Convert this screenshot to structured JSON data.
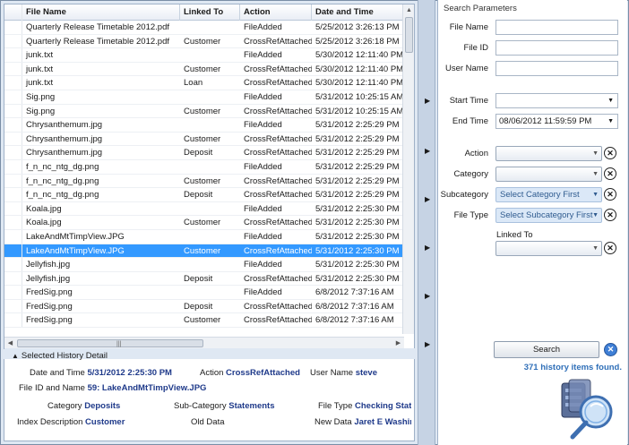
{
  "grid": {
    "columns": [
      "File Name",
      "Linked To",
      "Action",
      "Date and Time"
    ],
    "rows": [
      {
        "file": "Quarterly Release Timetable 2012.pdf",
        "linked": "",
        "action": "FileAdded",
        "date": "5/25/2012 3:26:13 PM",
        "selected": false
      },
      {
        "file": "Quarterly Release Timetable 2012.pdf",
        "linked": "Customer",
        "action": "CrossRefAttached",
        "date": "5/25/2012 3:26:18 PM",
        "selected": false
      },
      {
        "file": "junk.txt",
        "linked": "",
        "action": "FileAdded",
        "date": "5/30/2012 12:11:40 PM",
        "selected": false
      },
      {
        "file": "junk.txt",
        "linked": "Customer",
        "action": "CrossRefAttached",
        "date": "5/30/2012 12:11:40 PM",
        "selected": false
      },
      {
        "file": "junk.txt",
        "linked": "Loan",
        "action": "CrossRefAttached",
        "date": "5/30/2012 12:11:40 PM",
        "selected": false
      },
      {
        "file": "Sig.png",
        "linked": "",
        "action": "FileAdded",
        "date": "5/31/2012 10:25:15 AM",
        "selected": false
      },
      {
        "file": "Sig.png",
        "linked": "Customer",
        "action": "CrossRefAttached",
        "date": "5/31/2012 10:25:15 AM",
        "selected": false
      },
      {
        "file": "Chrysanthemum.jpg",
        "linked": "",
        "action": "FileAdded",
        "date": "5/31/2012 2:25:29 PM",
        "selected": false
      },
      {
        "file": "Chrysanthemum.jpg",
        "linked": "Customer",
        "action": "CrossRefAttached",
        "date": "5/31/2012 2:25:29 PM",
        "selected": false
      },
      {
        "file": "Chrysanthemum.jpg",
        "linked": "Deposit",
        "action": "CrossRefAttached",
        "date": "5/31/2012 2:25:29 PM",
        "selected": false
      },
      {
        "file": "f_n_nc_ntg_dg.png",
        "linked": "",
        "action": "FileAdded",
        "date": "5/31/2012 2:25:29 PM",
        "selected": false
      },
      {
        "file": "f_n_nc_ntg_dg.png",
        "linked": "Customer",
        "action": "CrossRefAttached",
        "date": "5/31/2012 2:25:29 PM",
        "selected": false
      },
      {
        "file": "f_n_nc_ntg_dg.png",
        "linked": "Deposit",
        "action": "CrossRefAttached",
        "date": "5/31/2012 2:25:29 PM",
        "selected": false
      },
      {
        "file": "Koala.jpg",
        "linked": "",
        "action": "FileAdded",
        "date": "5/31/2012 2:25:30 PM",
        "selected": false
      },
      {
        "file": "Koala.jpg",
        "linked": "Customer",
        "action": "CrossRefAttached",
        "date": "5/31/2012 2:25:30 PM",
        "selected": false
      },
      {
        "file": "LakeAndMtTimpView.JPG",
        "linked": "",
        "action": "FileAdded",
        "date": "5/31/2012 2:25:30 PM",
        "selected": false
      },
      {
        "file": "LakeAndMtTimpView.JPG",
        "linked": "Customer",
        "action": "CrossRefAttached",
        "date": "5/31/2012 2:25:30 PM",
        "selected": true
      },
      {
        "file": "Jellyfish.jpg",
        "linked": "",
        "action": "FileAdded",
        "date": "5/31/2012 2:25:30 PM",
        "selected": false
      },
      {
        "file": "Jellyfish.jpg",
        "linked": "Deposit",
        "action": "CrossRefAttached",
        "date": "5/31/2012 2:25:30 PM",
        "selected": false
      },
      {
        "file": "FredSig.png",
        "linked": "",
        "action": "FileAdded",
        "date": "6/8/2012 7:37:16 AM",
        "selected": false
      },
      {
        "file": "FredSig.png",
        "linked": "Deposit",
        "action": "CrossRefAttached",
        "date": "6/8/2012 7:37:16 AM",
        "selected": false
      },
      {
        "file": "FredSig.png",
        "linked": "Customer",
        "action": "CrossRefAttached",
        "date": "6/8/2012 7:37:16 AM",
        "selected": false
      }
    ]
  },
  "detail": {
    "title": "Selected History Detail",
    "date_label": "Date and Time",
    "date_value": "5/31/2012 2:25:30 PM",
    "action_label": "Action",
    "action_value": "CrossRefAttached",
    "user_label": "User Name",
    "user_value": "steve",
    "file_label": "File ID and Name",
    "file_value": "59: LakeAndMtTimpView.JPG",
    "category_label": "Category",
    "category_value": "Deposits",
    "subcategory_label": "Sub-Category",
    "subcategory_value": "Statements",
    "filetype_label": "File Type",
    "filetype_value": "Checking State",
    "index_label": "Index Description",
    "index_value": "Customer",
    "old_label": "Old Data",
    "new_label": "New Data",
    "new_value": "Jaret E Washing"
  },
  "search": {
    "title": "Search Parameters",
    "file_name_label": "File Name",
    "file_id_label": "File ID",
    "user_name_label": "User Name",
    "start_time_label": "Start Time",
    "end_time_label": "End Time",
    "end_time_value": "08/06/2012 11:59:59 PM",
    "action_label": "Action",
    "category_label": "Category",
    "subcategory_label": "Subcategory",
    "subcategory_hint": "Select Category First",
    "filetype_label": "File Type",
    "filetype_hint": "Select Subcategory First",
    "linked_label": "Linked To",
    "search_button": "Search",
    "result_text": "371 history items found."
  },
  "colors": {
    "selection": "#3399ff",
    "detail_value": "#1f3a8a",
    "result_text": "#2f6fb8"
  }
}
